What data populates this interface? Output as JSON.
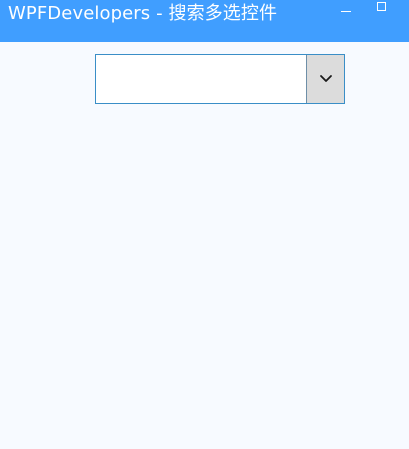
{
  "window": {
    "title": "WPFDevelopers - 搜索多选控件",
    "minimize_label": "",
    "maximize_label": ""
  },
  "multi_select_search": {
    "value": "",
    "placeholder": "",
    "toggle_icon": "chevron-down-icon"
  },
  "colors": {
    "titlebar": "#409eff",
    "background": "#f7faff",
    "combo_border": "#3a8ec7",
    "toggle_background": "#dcdcdc"
  }
}
